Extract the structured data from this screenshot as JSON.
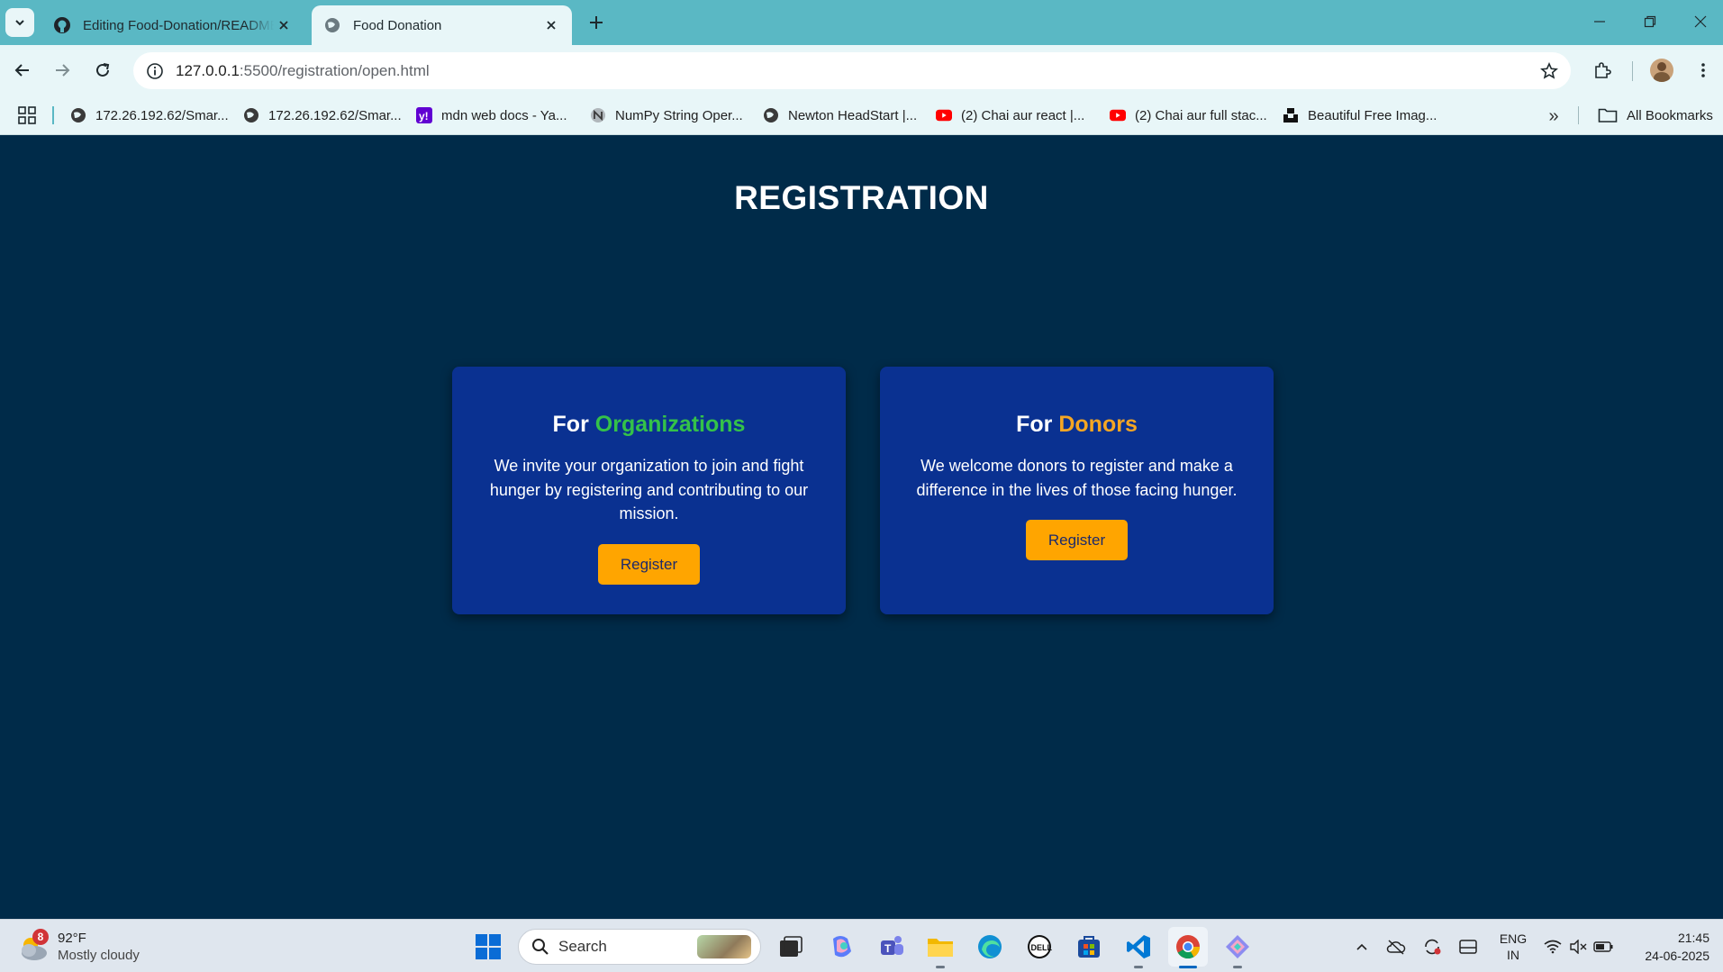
{
  "browser": {
    "tabs": [
      {
        "title": "Editing Food-Donation/README.md",
        "favicon": "github-icon",
        "active": false
      },
      {
        "title": "Food Donation",
        "favicon": "globe-icon",
        "active": true
      }
    ],
    "url_host": "127.0.0.1",
    "url_path": ":5500/registration/open.html",
    "bookmarks": [
      {
        "label": "172.26.192.62/Smar...",
        "icon": "globe-icon"
      },
      {
        "label": "172.26.192.62/Smar...",
        "icon": "globe-icon"
      },
      {
        "label": "mdn web docs - Ya...",
        "icon": "yahoo-icon"
      },
      {
        "label": "NumPy String Oper...",
        "icon": "numpy-icon"
      },
      {
        "label": "Newton HeadStart |...",
        "icon": "globe-icon"
      },
      {
        "label": "(2) Chai aur react |...",
        "icon": "youtube-icon"
      },
      {
        "label": "(2) Chai aur full stac...",
        "icon": "youtube-icon"
      },
      {
        "label": "Beautiful Free Imag...",
        "icon": "unsplash-icon"
      }
    ],
    "more_label": "»",
    "all_bookmarks": "All Bookmarks"
  },
  "page": {
    "title": "REGISTRATION",
    "cards": [
      {
        "heading_prefix": "For",
        "heading_highlight": "Organizations",
        "highlight_color": "#34c249",
        "text": "We invite your organization to join and fight hunger by registering and contributing to our mission.",
        "button": "Register"
      },
      {
        "heading_prefix": "For",
        "heading_highlight": "Donors",
        "highlight_color": "#f5a623",
        "text": "We welcome donors to register and make a difference in the lives of those facing hunger.",
        "button": "Register"
      }
    ]
  },
  "colors": {
    "page_bg": "#002b49",
    "card_bg": "#0a3191",
    "button_bg": "#ffa500",
    "chrome_accent": "#5ab8c4"
  },
  "taskbar": {
    "weather_badge": "8",
    "temperature": "92°F",
    "condition": "Mostly cloudy",
    "search_label": "Search",
    "lang_line1": "ENG",
    "lang_line2": "IN",
    "time": "21:45",
    "date": "24-06-2025"
  }
}
